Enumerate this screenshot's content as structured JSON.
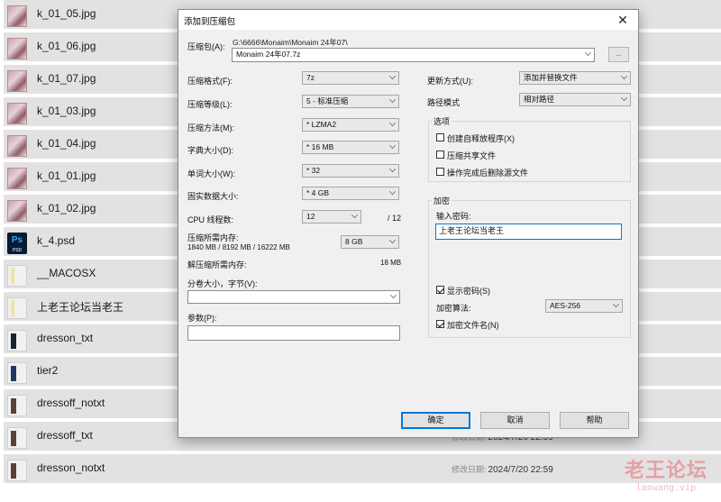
{
  "files": [
    {
      "name": "k_01_05.jpg",
      "kind": "image"
    },
    {
      "name": "k_01_06.jpg",
      "kind": "image"
    },
    {
      "name": "k_01_07.jpg",
      "kind": "image"
    },
    {
      "name": "k_01_03.jpg",
      "kind": "image"
    },
    {
      "name": "k_01_04.jpg",
      "kind": "image"
    },
    {
      "name": "k_01_01.jpg",
      "kind": "image"
    },
    {
      "name": "k_01_02.jpg",
      "kind": "image"
    },
    {
      "name": "k_4.psd",
      "kind": "psd",
      "icon_text": "Ps",
      "icon_sub": "PSD"
    },
    {
      "name": "__MACOSX",
      "kind": "folder"
    },
    {
      "name": "上老王论坛当老王",
      "kind": "folder"
    },
    {
      "name": "dresson_txt",
      "kind": "folder-dark"
    },
    {
      "name": "tier2",
      "kind": "folder-blue"
    },
    {
      "name": "dressoff_notxt",
      "kind": "folder-mix"
    },
    {
      "name": "dressoff_txt",
      "kind": "folder-mix",
      "date_label": "修改日期:",
      "date": "2024/7/20 22:59"
    },
    {
      "name": "dresson_notxt",
      "kind": "folder-mix",
      "date_label": "修改日期:",
      "date": "2024/7/20 22:59"
    }
  ],
  "watermark": {
    "text": "老王论坛",
    "url": "laowang.vip"
  },
  "dialog": {
    "title": "添加到压缩包",
    "close": "✕",
    "archive_label": "压缩包(A):",
    "archive_path": "G:\\6666\\Monaim\\Monaim 24年07\\",
    "archive_name": "Monaim 24年07.7z",
    "browse": "...",
    "format_label": "压缩格式(F):",
    "format": "7z",
    "level_label": "压缩等级(L):",
    "level": "5 - 标准压缩",
    "method_label": "压缩方法(M):",
    "method": "* LZMA2",
    "dict_label": "字典大小(D):",
    "dict": "* 16 MB",
    "word_label": "单词大小(W):",
    "word": "* 32",
    "solid_label": "固实数据大小:",
    "solid": "* 4 GB",
    "cpu_label": "CPU 线程数:",
    "cpu": "12",
    "cpu_total": "/ 12",
    "mem_comp_label": "压缩所需内存:",
    "mem_comp_detail": "1840 MB / 8192 MB / 16222 MB",
    "mem_comp_value": "8 GB",
    "mem_decomp_label": "解压缩所需内存:",
    "mem_decomp_value": "18 MB",
    "split_label": "分卷大小，字节(V):",
    "params_label": "参数(P):",
    "update_label": "更新方式(U):",
    "update": "添加并替换文件",
    "pathmode_label": "路径模式",
    "pathmode": "相对路径",
    "options_title": "选项",
    "opt_sfx": "创建自释放程序(X)",
    "opt_shared": "压缩共享文件",
    "opt_delete": "操作完成后删除源文件",
    "encrypt_title": "加密",
    "password_label": "输入密码:",
    "password": "上老王论坛当老王",
    "show_pw": "显示密码(S)",
    "enc_method_label": "加密算法:",
    "enc_method": "AES-256",
    "enc_names": "加密文件名(N)",
    "ok": "确定",
    "cancel": "取消",
    "help": "帮助"
  }
}
